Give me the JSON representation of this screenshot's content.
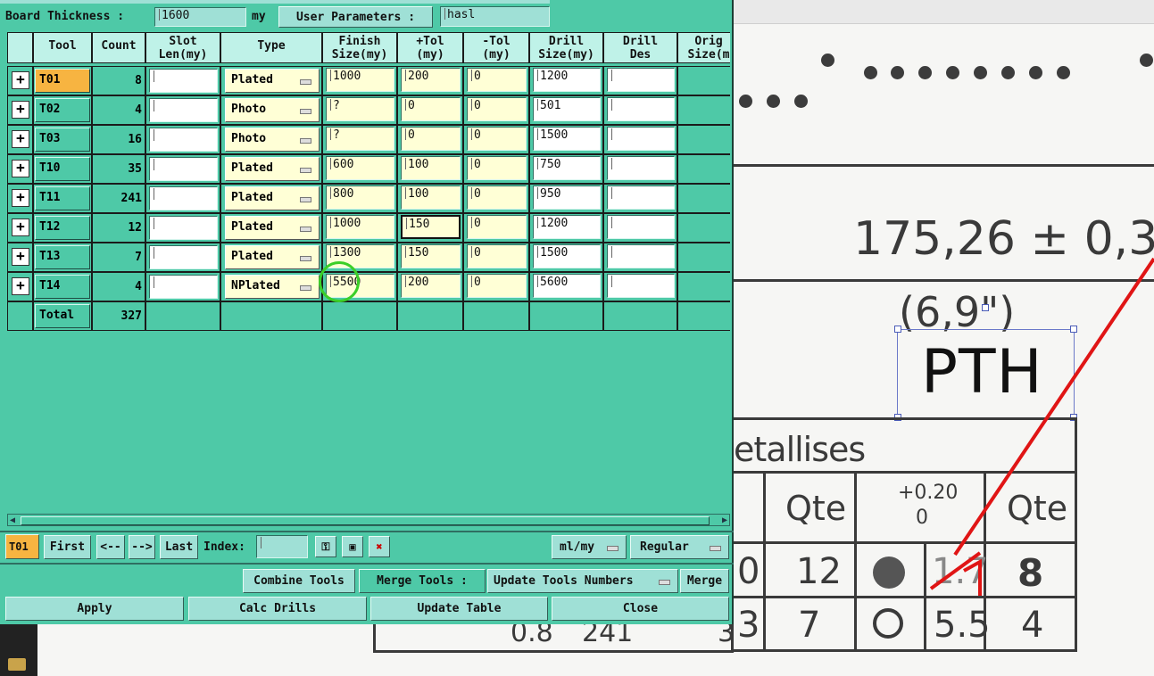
{
  "header": {
    "board_thickness_label": "Board Thickness :",
    "board_thickness_value": "1600",
    "board_thickness_unit": "my",
    "user_parameters_label": "User Parameters :",
    "user_parameters_value": "hasl"
  },
  "table": {
    "headers": {
      "tool": "Tool",
      "count": "Count",
      "slot_len_1": "Slot",
      "slot_len_2": "Len(my)",
      "type": "Type",
      "finish_1": "Finish",
      "finish_2": "Size(my)",
      "ptol_1": "+Tol",
      "ptol_2": "(my)",
      "mtol_1": "-Tol",
      "mtol_2": "(my)",
      "drill_1": "Drill",
      "drill_2": "Size(my)",
      "ddes_1": "Drill",
      "ddes_2": "Des",
      "orig_1": "Orig",
      "orig_2": "Size(m"
    },
    "rows": [
      {
        "tool": "T01",
        "count": "8",
        "type": "Plated",
        "finish": "1000",
        "ptol": "200",
        "mtol": "0",
        "drill": "1200"
      },
      {
        "tool": "T02",
        "count": "4",
        "type": "Photo",
        "finish": "?",
        "ptol": "0",
        "mtol": "0",
        "drill": "501"
      },
      {
        "tool": "T03",
        "count": "16",
        "type": "Photo",
        "finish": "?",
        "ptol": "0",
        "mtol": "0",
        "drill": "1500"
      },
      {
        "tool": "T10",
        "count": "35",
        "type": "Plated",
        "finish": "600",
        "ptol": "100",
        "mtol": "0",
        "drill": "750"
      },
      {
        "tool": "T11",
        "count": "241",
        "type": "Plated",
        "finish": "800",
        "ptol": "100",
        "mtol": "0",
        "drill": "950"
      },
      {
        "tool": "T12",
        "count": "12",
        "type": "Plated",
        "finish": "1000",
        "ptol": "150",
        "mtol": "0",
        "drill": "1200"
      },
      {
        "tool": "T13",
        "count": "7",
        "type": "Plated",
        "finish": "1300",
        "ptol": "150",
        "mtol": "0",
        "drill": "1500"
      },
      {
        "tool": "T14",
        "count": "4",
        "type": "NPlated",
        "finish": "5500",
        "ptol": "200",
        "mtol": "0",
        "drill": "5600"
      }
    ],
    "total_label": "Total",
    "total_count": "327"
  },
  "nav": {
    "current_tool": "T01",
    "first": "First",
    "prev": "<--",
    "next": "-->",
    "last": "Last",
    "index_label": "Index:",
    "unit_select": "ml/my",
    "mode_select": "Regular"
  },
  "actions": {
    "combine_tools": "Combine Tools",
    "merge_tools_label": "Merge Tools :",
    "merge_select": "Update Tools Numbers",
    "merge": "Merge",
    "apply": "Apply",
    "calc_drills": "Calc Drills",
    "update_table": "Update Table",
    "close": "Close"
  },
  "document": {
    "dimension": "175,26 ± 0,3",
    "dimension_inch": "(6,9\")",
    "pth_label": "PTH",
    "section_title": "etallises",
    "tol_plus": "+0.20",
    "tol_zero": "0",
    "col_qte_1": "Qte",
    "col_qte_2": "Qte",
    "row1": [
      "0",
      "12",
      "1.7",
      "8"
    ],
    "row2": [
      "3",
      "7",
      "5.5",
      "4"
    ],
    "bottom_cells": [
      "0.8",
      "241",
      "3"
    ]
  },
  "colors": {
    "dialog_bg": "#4ec9a7",
    "selected_tool": "#f7b441",
    "input_yellow": "#ffffd6",
    "annotation_red": "#e01515",
    "highlight_green": "#3bcf28"
  }
}
